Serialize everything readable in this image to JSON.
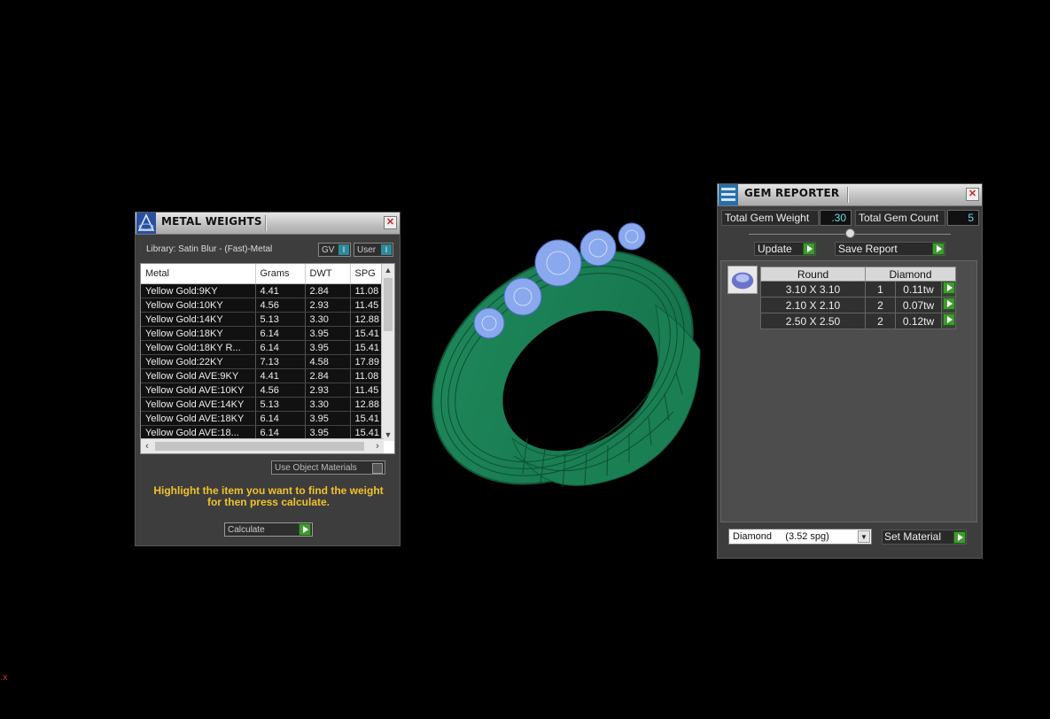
{
  "metal_weights": {
    "title": "METAL WEIGHTS",
    "library_label": "Library: Satin Blur - (Fast)-Metal",
    "toggle_gv": "GV",
    "toggle_user": "User",
    "toggle_knob": "I",
    "columns": [
      "Metal",
      "Grams",
      "DWT",
      "SPG"
    ],
    "rows": [
      [
        "Yellow Gold:9KY",
        "4.41",
        "2.84",
        "11.08"
      ],
      [
        "Yellow Gold:10KY",
        "4.56",
        "2.93",
        "11.45"
      ],
      [
        "Yellow Gold:14KY",
        "5.13",
        "3.30",
        "12.88"
      ],
      [
        "Yellow Gold:18KY",
        "6.14",
        "3.95",
        "15.41"
      ],
      [
        "Yellow Gold:18KY R...",
        "6.14",
        "3.95",
        "15.41"
      ],
      [
        "Yellow Gold:22KY",
        "7.13",
        "4.58",
        "17.89"
      ],
      [
        "Yellow Gold AVE:9KY",
        "4.41",
        "2.84",
        "11.08"
      ],
      [
        "Yellow Gold AVE:10KY",
        "4.56",
        "2.93",
        "11.45"
      ],
      [
        "Yellow Gold AVE:14KY",
        "5.13",
        "3.30",
        "12.88"
      ],
      [
        "Yellow Gold AVE:18KY",
        "6.14",
        "3.95",
        "15.41"
      ],
      [
        "Yellow Gold AVE:18...",
        "6.14",
        "3.95",
        "15.41"
      ]
    ],
    "use_object_materials": "Use Object Materials",
    "hint": "Highlight the item you want to find the weight for then press calculate.",
    "calculate_label": "Calculate"
  },
  "gem_reporter": {
    "title": "GEM REPORTER",
    "total_weight_label": "Total Gem Weight",
    "total_weight_value": ".30",
    "total_count_label": "Total Gem Count",
    "total_count_value": "5",
    "update_label": "Update",
    "save_report_label": "Save Report",
    "table_headers": [
      "Round",
      "Diamond"
    ],
    "gems": [
      {
        "size": "3.10 X 3.10",
        "count": "1",
        "weight": "0.11tw"
      },
      {
        "size": "2.10 X 2.10",
        "count": "2",
        "weight": "0.07tw"
      },
      {
        "size": "2.50 X 2.50",
        "count": "2",
        "weight": "0.12tw"
      }
    ],
    "material_select": "Diamond     (3.52 spg)",
    "set_material_label": "Set Material"
  },
  "viewport": {
    "corner_mark": ".x"
  },
  "colors": {
    "ring_green": "#1f8a5c",
    "gem_blue": "#8aa8ee",
    "hint_yellow": "#f2c22b",
    "action_green": "#3f9b2f"
  }
}
